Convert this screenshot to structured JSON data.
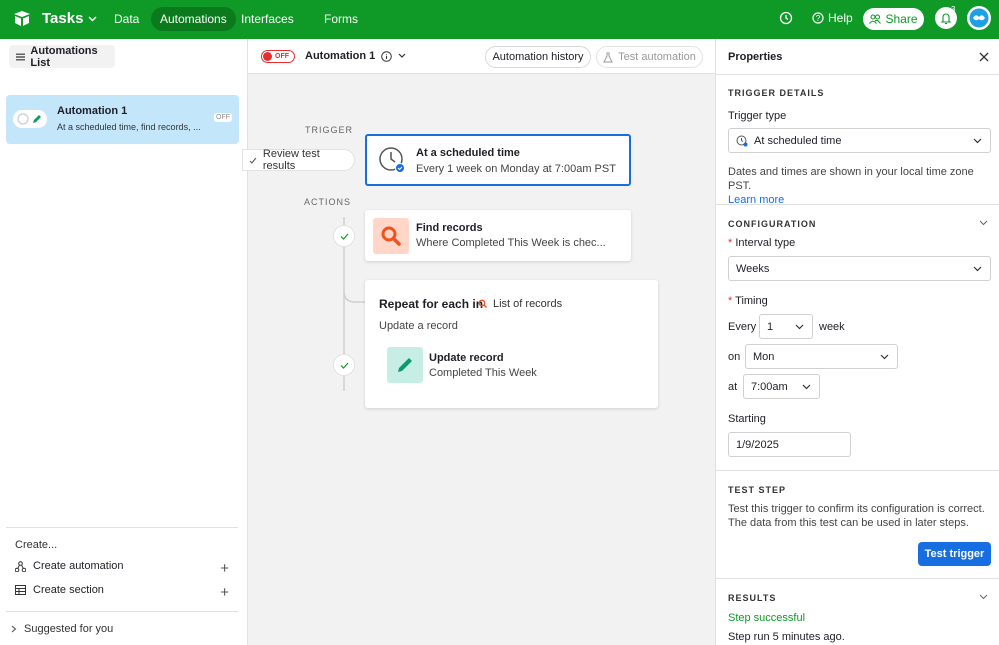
{
  "topbar": {
    "base_name": "Tasks",
    "tabs": [
      {
        "label": "Data"
      },
      {
        "label": "Automations"
      },
      {
        "label": "Interfaces"
      },
      {
        "label": "Forms"
      }
    ],
    "help_label": "Help",
    "share_label": "Share",
    "notification_count": "3",
    "colors": {
      "bar": "#0f9927"
    }
  },
  "sidebar": {
    "list_button_label": "Automations List",
    "automation": {
      "name": "Automation 1",
      "description": "At a scheduled time, find records, ...",
      "status": "OFF"
    },
    "create_label": "Create...",
    "create_items": [
      {
        "label": "Create automation",
        "icon": "automation-icon"
      },
      {
        "label": "Create section",
        "icon": "grid-icon"
      }
    ],
    "suggested_label": "Suggested for you"
  },
  "canvas": {
    "toggle_label": "OFF",
    "automation_title": "Automation 1",
    "history_button": "Automation history",
    "test_button": "Test automation",
    "trigger_label": "TRIGGER",
    "actions_label": "ACTIONS",
    "review_label": "Review test results",
    "trigger_card": {
      "title": "At a scheduled time",
      "subtitle": "Every 1 week on Monday at 7:00am PST"
    },
    "find_card": {
      "title": "Find records",
      "subtitle": "Where Completed This Week is chec..."
    },
    "repeat_card": {
      "title": "Repeat for each in",
      "list_label": "List of records",
      "subtitle": "Update a record",
      "inner_title": "Update record",
      "inner_subtitle": "Completed This Week"
    }
  },
  "properties": {
    "title": "Properties",
    "trigger_details_heading": "TRIGGER DETAILS",
    "trigger_type_label": "Trigger type",
    "trigger_type_value": "At scheduled time",
    "timezone_note": "Dates and times are shown in your local time zone PST.",
    "learn_more": "Learn more",
    "configuration_heading": "CONFIGURATION",
    "interval_type_label": "Interval type",
    "interval_type_value": "Weeks",
    "timing_label": "Timing",
    "every_label": "Every",
    "every_value": "1",
    "week_label": "week",
    "on_label": "on",
    "on_value": "Mon",
    "at_label": "at",
    "at_value": "7:00am",
    "starting_label": "Starting",
    "starting_value": "1/9/2025",
    "test_step_heading": "TEST STEP",
    "test_step_text": "Test this trigger to confirm its configuration is correct. The data from this test can be used in later steps.",
    "test_trigger_button": "Test trigger",
    "results_heading": "RESULTS",
    "results_status": "Step successful",
    "results_time": "Step run 5 minutes ago."
  }
}
